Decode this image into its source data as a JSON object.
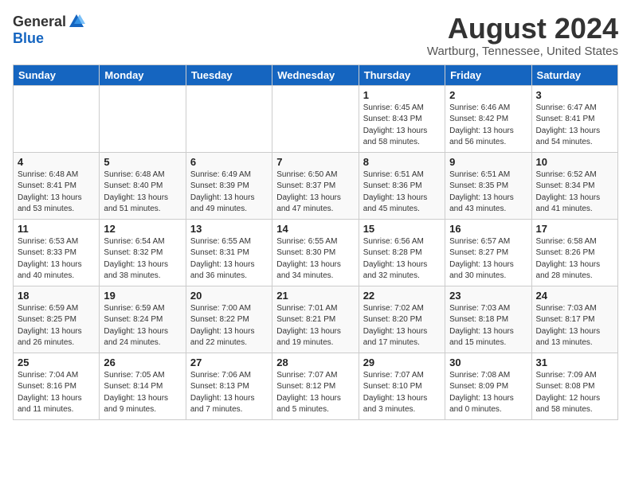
{
  "header": {
    "logo_general": "General",
    "logo_blue": "Blue",
    "month_year": "August 2024",
    "location": "Wartburg, Tennessee, United States"
  },
  "weekdays": [
    "Sunday",
    "Monday",
    "Tuesday",
    "Wednesday",
    "Thursday",
    "Friday",
    "Saturday"
  ],
  "weeks": [
    [
      {
        "day": "",
        "info": ""
      },
      {
        "day": "",
        "info": ""
      },
      {
        "day": "",
        "info": ""
      },
      {
        "day": "",
        "info": ""
      },
      {
        "day": "1",
        "info": "Sunrise: 6:45 AM\nSunset: 8:43 PM\nDaylight: 13 hours\nand 58 minutes."
      },
      {
        "day": "2",
        "info": "Sunrise: 6:46 AM\nSunset: 8:42 PM\nDaylight: 13 hours\nand 56 minutes."
      },
      {
        "day": "3",
        "info": "Sunrise: 6:47 AM\nSunset: 8:41 PM\nDaylight: 13 hours\nand 54 minutes."
      }
    ],
    [
      {
        "day": "4",
        "info": "Sunrise: 6:48 AM\nSunset: 8:41 PM\nDaylight: 13 hours\nand 53 minutes."
      },
      {
        "day": "5",
        "info": "Sunrise: 6:48 AM\nSunset: 8:40 PM\nDaylight: 13 hours\nand 51 minutes."
      },
      {
        "day": "6",
        "info": "Sunrise: 6:49 AM\nSunset: 8:39 PM\nDaylight: 13 hours\nand 49 minutes."
      },
      {
        "day": "7",
        "info": "Sunrise: 6:50 AM\nSunset: 8:37 PM\nDaylight: 13 hours\nand 47 minutes."
      },
      {
        "day": "8",
        "info": "Sunrise: 6:51 AM\nSunset: 8:36 PM\nDaylight: 13 hours\nand 45 minutes."
      },
      {
        "day": "9",
        "info": "Sunrise: 6:51 AM\nSunset: 8:35 PM\nDaylight: 13 hours\nand 43 minutes."
      },
      {
        "day": "10",
        "info": "Sunrise: 6:52 AM\nSunset: 8:34 PM\nDaylight: 13 hours\nand 41 minutes."
      }
    ],
    [
      {
        "day": "11",
        "info": "Sunrise: 6:53 AM\nSunset: 8:33 PM\nDaylight: 13 hours\nand 40 minutes."
      },
      {
        "day": "12",
        "info": "Sunrise: 6:54 AM\nSunset: 8:32 PM\nDaylight: 13 hours\nand 38 minutes."
      },
      {
        "day": "13",
        "info": "Sunrise: 6:55 AM\nSunset: 8:31 PM\nDaylight: 13 hours\nand 36 minutes."
      },
      {
        "day": "14",
        "info": "Sunrise: 6:55 AM\nSunset: 8:30 PM\nDaylight: 13 hours\nand 34 minutes."
      },
      {
        "day": "15",
        "info": "Sunrise: 6:56 AM\nSunset: 8:28 PM\nDaylight: 13 hours\nand 32 minutes."
      },
      {
        "day": "16",
        "info": "Sunrise: 6:57 AM\nSunset: 8:27 PM\nDaylight: 13 hours\nand 30 minutes."
      },
      {
        "day": "17",
        "info": "Sunrise: 6:58 AM\nSunset: 8:26 PM\nDaylight: 13 hours\nand 28 minutes."
      }
    ],
    [
      {
        "day": "18",
        "info": "Sunrise: 6:59 AM\nSunset: 8:25 PM\nDaylight: 13 hours\nand 26 minutes."
      },
      {
        "day": "19",
        "info": "Sunrise: 6:59 AM\nSunset: 8:24 PM\nDaylight: 13 hours\nand 24 minutes."
      },
      {
        "day": "20",
        "info": "Sunrise: 7:00 AM\nSunset: 8:22 PM\nDaylight: 13 hours\nand 22 minutes."
      },
      {
        "day": "21",
        "info": "Sunrise: 7:01 AM\nSunset: 8:21 PM\nDaylight: 13 hours\nand 19 minutes."
      },
      {
        "day": "22",
        "info": "Sunrise: 7:02 AM\nSunset: 8:20 PM\nDaylight: 13 hours\nand 17 minutes."
      },
      {
        "day": "23",
        "info": "Sunrise: 7:03 AM\nSunset: 8:18 PM\nDaylight: 13 hours\nand 15 minutes."
      },
      {
        "day": "24",
        "info": "Sunrise: 7:03 AM\nSunset: 8:17 PM\nDaylight: 13 hours\nand 13 minutes."
      }
    ],
    [
      {
        "day": "25",
        "info": "Sunrise: 7:04 AM\nSunset: 8:16 PM\nDaylight: 13 hours\nand 11 minutes."
      },
      {
        "day": "26",
        "info": "Sunrise: 7:05 AM\nSunset: 8:14 PM\nDaylight: 13 hours\nand 9 minutes."
      },
      {
        "day": "27",
        "info": "Sunrise: 7:06 AM\nSunset: 8:13 PM\nDaylight: 13 hours\nand 7 minutes."
      },
      {
        "day": "28",
        "info": "Sunrise: 7:07 AM\nSunset: 8:12 PM\nDaylight: 13 hours\nand 5 minutes."
      },
      {
        "day": "29",
        "info": "Sunrise: 7:07 AM\nSunset: 8:10 PM\nDaylight: 13 hours\nand 3 minutes."
      },
      {
        "day": "30",
        "info": "Sunrise: 7:08 AM\nSunset: 8:09 PM\nDaylight: 13 hours\nand 0 minutes."
      },
      {
        "day": "31",
        "info": "Sunrise: 7:09 AM\nSunset: 8:08 PM\nDaylight: 12 hours\nand 58 minutes."
      }
    ]
  ]
}
